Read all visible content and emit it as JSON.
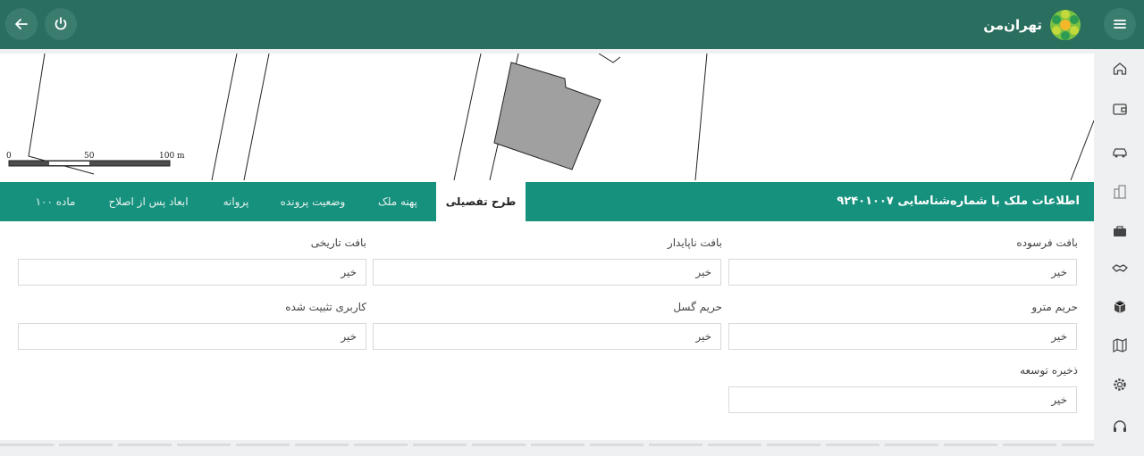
{
  "app": {
    "logo_text": "تهران‌من"
  },
  "topbar": {
    "menu_icon": "hamburger-menu-icon",
    "back_icon": "arrow-left-icon",
    "power_icon": "power-icon"
  },
  "map": {
    "scale_labels": [
      "0",
      "50",
      "100 m"
    ]
  },
  "panel": {
    "title": "اطلاعات ملک با شماره‌شناسایی ۹۲۴۰۱۰۰۷",
    "tabs": [
      {
        "label": "طرح تفصیلی",
        "active": true
      },
      {
        "label": "پهنه ملک",
        "active": false
      },
      {
        "label": "وضعیت پرونده",
        "active": false
      },
      {
        "label": "پروانه",
        "active": false
      },
      {
        "label": "ابعاد پس از اصلاح",
        "active": false
      },
      {
        "label": "ماده ۱۰۰",
        "active": false
      }
    ]
  },
  "fields": [
    {
      "label": "بافت فرسوده",
      "value": "خیر"
    },
    {
      "label": "بافت ناپایدار",
      "value": "خیر"
    },
    {
      "label": "بافت تاریخی",
      "value": "خیر"
    },
    {
      "label": "حریم مترو",
      "value": "خیر"
    },
    {
      "label": "حریم گسل",
      "value": "خیر"
    },
    {
      "label": "کاربری تثبیت شده",
      "value": "خیر"
    },
    {
      "label": "ذخیره توسعه",
      "value": "خیر"
    }
  ],
  "sidebar": {
    "icons": [
      "home-icon",
      "wallet-icon",
      "car-icon",
      "buildings-icon",
      "briefcase-icon",
      "handshake-icon",
      "box-icon",
      "map-icon",
      "settings-icon",
      "headset-icon"
    ]
  },
  "colors": {
    "topbar": "#2a6e5f",
    "tabbar": "#16917e",
    "parcel_fill": "#a0a0a0"
  }
}
